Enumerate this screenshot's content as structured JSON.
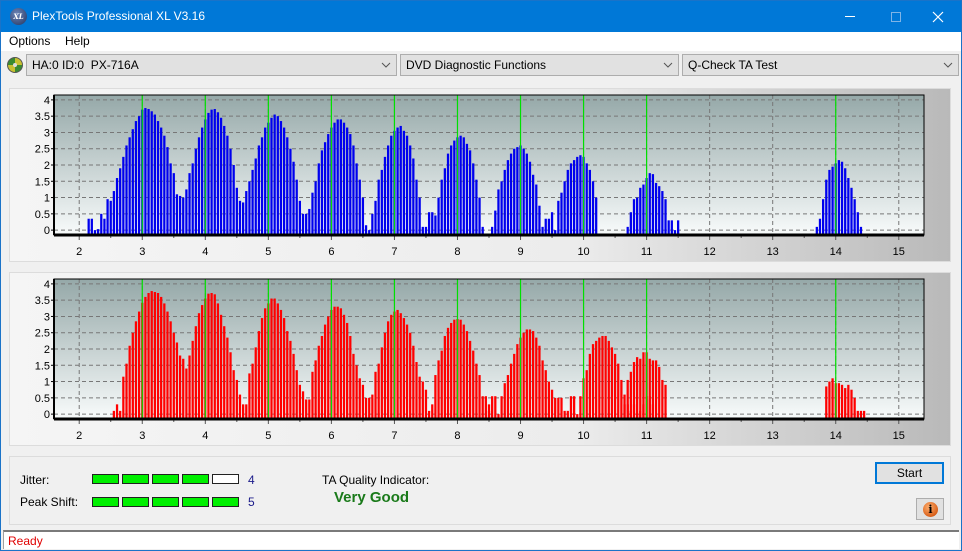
{
  "window": {
    "title": "PlexTools Professional XL V3.16",
    "app_icon_label": "XL",
    "controls": [
      "minimize",
      "maximize",
      "close"
    ]
  },
  "menu": {
    "items": [
      {
        "label": "Options"
      },
      {
        "label": "Help"
      }
    ]
  },
  "toolbar": {
    "drive_icon": "cd-drive-icon",
    "drive_select": "HA:0 ID:0  PX-716A",
    "function_select": "DVD Diagnostic Functions",
    "test_select": "Q-Check TA Test"
  },
  "colors": {
    "titlebar": "#0078d7",
    "series_top": "#0000ee",
    "series_bottom": "#ff0000",
    "marker_lines": "#00e000",
    "meter_on": "#00f000",
    "quality_text": "#1a7a1a",
    "status_text": "#e00000"
  },
  "chart_data": [
    {
      "type": "bar",
      "title": "",
      "xlabel": "",
      "ylabel": "",
      "xlim": [
        1.6,
        15.4
      ],
      "ylim": [
        -0.15,
        4.15
      ],
      "x_ticks": [
        "2",
        "3",
        "4",
        "5",
        "6",
        "7",
        "8",
        "9",
        "10",
        "11",
        "12",
        "13",
        "14",
        "15"
      ],
      "y_ticks": [
        "0",
        "0.5",
        "1",
        "1.5",
        "2",
        "2.5",
        "3",
        "3.5",
        "4"
      ],
      "grid": true,
      "marker_lines_x": [
        3,
        4,
        5,
        6,
        7,
        8,
        9,
        10,
        11,
        14
      ],
      "bar_step": 0.05,
      "series": [
        {
          "name": "top",
          "segments": [
            {
              "start": 2.15,
              "values": [
                0.35,
                0.35,
                0,
                0.03,
                0.5,
                0.35,
                0.95,
                0.9,
                1.2,
                1.6,
                1.9,
                2.25,
                2.6,
                2.85,
                3.1,
                3.35,
                3.5,
                3.7,
                3.75,
                3.72,
                3.65,
                3.55,
                3.35,
                3.15,
                2.9,
                2.55,
                2.05,
                1.75,
                1.1,
                1.05,
                1.0,
                1.25,
                1.75,
                2.05,
                2.5,
                2.85,
                3.15,
                3.4,
                3.6,
                3.7,
                3.72,
                3.62,
                3.45,
                3.2,
                2.9,
                2.5,
                2.0,
                1.3,
                0.9,
                0.85,
                1.2,
                1.5,
                1.85,
                2.2,
                2.6,
                2.85,
                3.15,
                3.3,
                3.45,
                3.55,
                3.5,
                3.35,
                3.15,
                2.85,
                2.5,
                2.1,
                1.55,
                0.9,
                0.5,
                0.5,
                0.65,
                1.15,
                1.5,
                2.05,
                2.45,
                2.7,
                2.95,
                3.15,
                3.3,
                3.4,
                3.4,
                3.3,
                3.15,
                2.95,
                2.6,
                2.05,
                1.55,
                1.0,
                0.15,
                0,
                0.5,
                0.9,
                1.55,
                1.85,
                2.25,
                2.6,
                2.9,
                3.05,
                3.15,
                3.2,
                3.05,
                2.9,
                2.6,
                2.2,
                1.55,
                1.0,
                0.1,
                0.1,
                0.55,
                0.55,
                0.45,
                1.0,
                1.55,
                1.9,
                2.35,
                2.6,
                2.75,
                2.85,
                2.9,
                2.85,
                2.65,
                2.45,
                2.05,
                1.55,
                1.0,
                0.1
              ]
            },
            {
              "start": 8.55,
              "values": [
                0.1,
                0.6,
                1.25,
                1.5,
                1.85,
                2.15,
                2.35,
                2.5,
                2.55,
                2.6,
                2.5,
                2.35,
                2.1,
                1.7,
                1.4,
                0.75,
                0.1,
                0.35,
                0.35,
                0.55,
                0,
                0.9,
                1.15,
                1.5,
                1.85,
                2.05,
                2.15,
                2.25,
                2.3,
                2.25,
                2.05,
                1.85,
                1.5,
                1.0
              ]
            },
            {
              "start": 10.7,
              "values": [
                0.1,
                0.55,
                0.95,
                1.0,
                1.3,
                1.4,
                1.6,
                1.75,
                1.72,
                1.45,
                1.35,
                1.2,
                0.95,
                0.3,
                0.3,
                0,
                0.3
              ]
            },
            {
              "start": 13.7,
              "values": [
                0.1,
                0.35,
                0.95,
                1.55,
                1.85,
                1.95,
                2.05,
                2.15,
                2.1,
                1.9,
                1.6,
                1.3,
                0.95,
                0.55,
                0.1
              ]
            }
          ]
        },
        {
          "name": "bottom",
          "segments": [
            {
              "start": 2.55,
              "values": [
                0.1,
                0.3,
                0.1,
                1.15,
                1.55,
                2.1,
                2.5,
                2.85,
                3.15,
                3.42,
                3.6,
                3.72,
                3.78,
                3.75,
                3.72,
                3.6,
                3.4,
                3.15,
                2.85,
                2.5,
                2.2,
                1.8,
                1.7,
                1.4,
                1.8,
                2.25,
                2.7,
                3.1,
                3.35,
                3.55,
                3.7,
                3.72,
                3.68,
                3.4,
                3.05,
                2.7,
                2.35,
                1.9,
                1.35,
                1.05,
                0.6,
                0.3,
                0.3,
                1.25,
                1.55,
                2.05,
                2.55,
                2.95,
                3.25,
                3.4,
                3.55,
                3.55,
                3.4,
                3.2,
                2.95,
                2.55,
                2.25,
                1.85,
                1.35,
                0.9,
                0.7,
                0.45,
                0.45,
                1.3,
                1.65,
                2.1,
                2.4,
                2.75,
                3.0,
                3.2,
                3.3,
                3.3,
                3.25,
                3.05,
                2.8,
                2.4,
                1.85,
                1.5,
                1.1,
                0.9,
                0.5,
                0.5,
                0.6,
                1.3,
                1.55,
                2.05,
                2.5,
                2.85,
                3.05,
                3.15,
                3.2,
                3.1,
                2.95,
                2.75,
                2.5,
                2.1,
                1.6,
                1.15,
                1.0,
                0.75,
                0.1,
                0.3,
                1.2,
                1.65,
                1.95,
                2.4,
                2.65,
                2.8,
                2.9,
                2.92,
                2.9,
                2.75,
                2.55,
                2.25,
                1.95,
                1.55,
                1.2,
                0.55,
                0.55,
                0.3
              ]
            },
            {
              "start": 8.5,
              "values": [
                0.1,
                0.55,
                0.55,
                0,
                0.55,
                0.95,
                1.2,
                1.55,
                1.85,
                2.15,
                2.35,
                2.5,
                2.6,
                2.6,
                2.55,
                2.35,
                2.1,
                1.65,
                1.35,
                1.0,
                0.75,
                0.5,
                0.5,
                0.5,
                0.1,
                0.1,
                0.55,
                0.55,
                0,
                0.55,
                1.1,
                1.35,
                1.85,
                2.15,
                2.25,
                2.35,
                2.4,
                2.4,
                2.25,
                2.05,
                1.85,
                1.55,
                1.05,
                0.6,
                0.3,
                0.1,
                0.3,
                0,
                0.1,
                0.3,
                0.55,
                0.55,
                0.3
              ]
            },
            {
              "start": 10.65,
              "values": [
                0.3,
                1.05,
                1.3,
                1.6,
                1.75,
                1.7,
                1.9,
                1.9,
                1.7,
                1.65,
                1.65,
                1.45,
                1.05,
                0.9
              ]
            },
            {
              "start": 13.85,
              "values": [
                0.85,
                1.0,
                1.1,
                0.95,
                0.95,
                0.9,
                0.8,
                0.9,
                0.75,
                0.5,
                0.1,
                0.1,
                0.1
              ]
            }
          ]
        }
      ]
    }
  ],
  "results": {
    "jitter": {
      "label": "Jitter:",
      "value": "4",
      "segments_total": 5,
      "segments_on": 4
    },
    "peak_shift": {
      "label": "Peak Shift:",
      "value": "5",
      "segments_total": 5,
      "segments_on": 5
    },
    "quality_label": "TA Quality Indicator:",
    "quality_value": "Very Good"
  },
  "buttons": {
    "start": "Start",
    "info_icon": "info-icon"
  },
  "status": "Ready"
}
